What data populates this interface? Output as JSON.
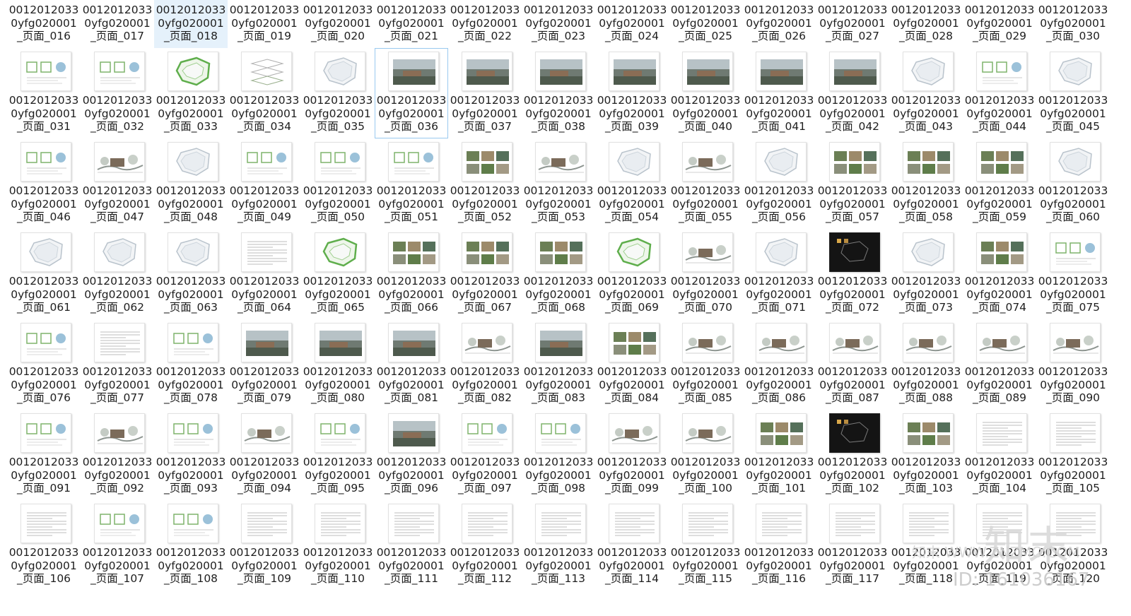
{
  "files": {
    "prefix_line1": "0012012033",
    "prefix_line2": "0yfg020001",
    "page_prefix": "_页面_",
    "items": [
      {
        "page": "016",
        "thumb": "none"
      },
      {
        "page": "017",
        "thumb": "none"
      },
      {
        "page": "018",
        "thumb": "none",
        "selected": true
      },
      {
        "page": "019",
        "thumb": "none"
      },
      {
        "page": "020",
        "thumb": "none"
      },
      {
        "page": "021",
        "thumb": "none"
      },
      {
        "page": "022",
        "thumb": "none"
      },
      {
        "page": "023",
        "thumb": "none"
      },
      {
        "page": "024",
        "thumb": "none"
      },
      {
        "page": "025",
        "thumb": "none"
      },
      {
        "page": "026",
        "thumb": "none"
      },
      {
        "page": "027",
        "thumb": "none"
      },
      {
        "page": "028",
        "thumb": "none"
      },
      {
        "page": "029",
        "thumb": "none"
      },
      {
        "page": "030",
        "thumb": "none"
      },
      {
        "page": "031",
        "thumb": "diagram"
      },
      {
        "page": "032",
        "thumb": "diagram"
      },
      {
        "page": "033",
        "thumb": "map-green"
      },
      {
        "page": "034",
        "thumb": "layers"
      },
      {
        "page": "035",
        "thumb": "map"
      },
      {
        "page": "036",
        "thumb": "photo",
        "focused": true
      },
      {
        "page": "037",
        "thumb": "photo"
      },
      {
        "page": "038",
        "thumb": "photo"
      },
      {
        "page": "039",
        "thumb": "photo"
      },
      {
        "page": "040",
        "thumb": "photo"
      },
      {
        "page": "041",
        "thumb": "photo"
      },
      {
        "page": "042",
        "thumb": "photo"
      },
      {
        "page": "043",
        "thumb": "map"
      },
      {
        "page": "044",
        "thumb": "diagram"
      },
      {
        "page": "045",
        "thumb": "map"
      },
      {
        "page": "046",
        "thumb": "diagram"
      },
      {
        "page": "047",
        "thumb": "section"
      },
      {
        "page": "048",
        "thumb": "map"
      },
      {
        "page": "049",
        "thumb": "diagram"
      },
      {
        "page": "050",
        "thumb": "diagram"
      },
      {
        "page": "051",
        "thumb": "diagram"
      },
      {
        "page": "052",
        "thumb": "photos"
      },
      {
        "page": "053",
        "thumb": "section"
      },
      {
        "page": "054",
        "thumb": "map"
      },
      {
        "page": "055",
        "thumb": "section"
      },
      {
        "page": "056",
        "thumb": "map"
      },
      {
        "page": "057",
        "thumb": "photos"
      },
      {
        "page": "058",
        "thumb": "photos"
      },
      {
        "page": "059",
        "thumb": "photos"
      },
      {
        "page": "060",
        "thumb": "map"
      },
      {
        "page": "061",
        "thumb": "map"
      },
      {
        "page": "062",
        "thumb": "map"
      },
      {
        "page": "063",
        "thumb": "map"
      },
      {
        "page": "064",
        "thumb": "text"
      },
      {
        "page": "065",
        "thumb": "map-green"
      },
      {
        "page": "066",
        "thumb": "photos"
      },
      {
        "page": "067",
        "thumb": "photos"
      },
      {
        "page": "068",
        "thumb": "photos"
      },
      {
        "page": "069",
        "thumb": "map-green"
      },
      {
        "page": "070",
        "thumb": "section"
      },
      {
        "page": "071",
        "thumb": "map"
      },
      {
        "page": "072",
        "thumb": "dark"
      },
      {
        "page": "073",
        "thumb": "map"
      },
      {
        "page": "074",
        "thumb": "photos"
      },
      {
        "page": "075",
        "thumb": "diagram"
      },
      {
        "page": "076",
        "thumb": "diagram"
      },
      {
        "page": "077",
        "thumb": "text"
      },
      {
        "page": "078",
        "thumb": "diagram"
      },
      {
        "page": "079",
        "thumb": "photo"
      },
      {
        "page": "080",
        "thumb": "photo"
      },
      {
        "page": "081",
        "thumb": "photo"
      },
      {
        "page": "082",
        "thumb": "section"
      },
      {
        "page": "083",
        "thumb": "photo"
      },
      {
        "page": "084",
        "thumb": "photos"
      },
      {
        "page": "085",
        "thumb": "section"
      },
      {
        "page": "086",
        "thumb": "section"
      },
      {
        "page": "087",
        "thumb": "section"
      },
      {
        "page": "088",
        "thumb": "section"
      },
      {
        "page": "089",
        "thumb": "section"
      },
      {
        "page": "090",
        "thumb": "section"
      },
      {
        "page": "091",
        "thumb": "diagram"
      },
      {
        "page": "092",
        "thumb": "section"
      },
      {
        "page": "093",
        "thumb": "diagram"
      },
      {
        "page": "094",
        "thumb": "section"
      },
      {
        "page": "095",
        "thumb": "diagram"
      },
      {
        "page": "096",
        "thumb": "photo"
      },
      {
        "page": "097",
        "thumb": "diagram"
      },
      {
        "page": "098",
        "thumb": "diagram"
      },
      {
        "page": "099",
        "thumb": "section"
      },
      {
        "page": "100",
        "thumb": "section"
      },
      {
        "page": "101",
        "thumb": "photos"
      },
      {
        "page": "102",
        "thumb": "dark"
      },
      {
        "page": "103",
        "thumb": "photos"
      },
      {
        "page": "104",
        "thumb": "text"
      },
      {
        "page": "105",
        "thumb": "text"
      },
      {
        "page": "106",
        "thumb": "text"
      },
      {
        "page": "107",
        "thumb": "diagram"
      },
      {
        "page": "108",
        "thumb": "diagram"
      },
      {
        "page": "109",
        "thumb": "text"
      },
      {
        "page": "110",
        "thumb": "text"
      },
      {
        "page": "111",
        "thumb": "text"
      },
      {
        "page": "112",
        "thumb": "text"
      },
      {
        "page": "113",
        "thumb": "text"
      },
      {
        "page": "114",
        "thumb": "text"
      },
      {
        "page": "115",
        "thumb": "text"
      },
      {
        "page": "116",
        "thumb": "text"
      },
      {
        "page": "117",
        "thumb": "text"
      },
      {
        "page": "118",
        "thumb": "text"
      },
      {
        "page": "119",
        "thumb": "text"
      },
      {
        "page": "120",
        "thumb": "text"
      }
    ]
  },
  "watermark": {
    "logo_text": "知末",
    "site_text": "知末 WWW.ZNZMO.COM",
    "id_text": "ID: 161036167"
  },
  "colors": {
    "selection": "#e5f1fb",
    "focus_border": "#99c9ef",
    "text": "#1e1e1e"
  }
}
